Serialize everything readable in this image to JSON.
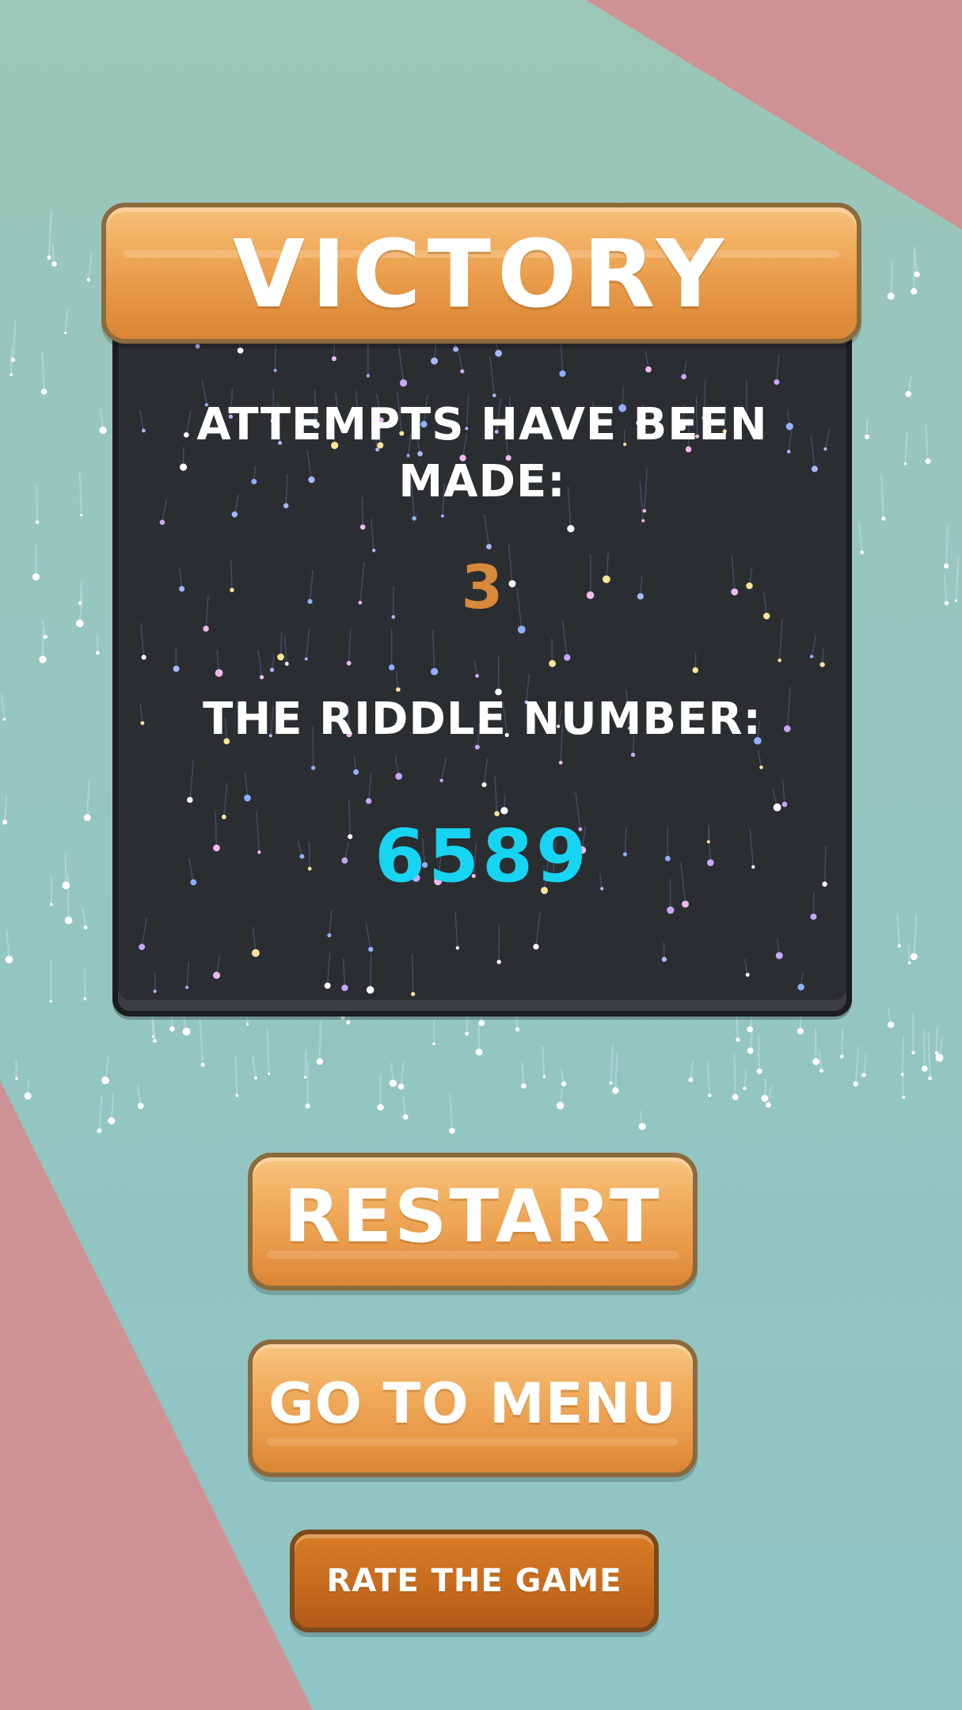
{
  "banner": {
    "title": "VICTORY"
  },
  "results": {
    "attempts_label": "ATTEMPTS HAVE BEEN MADE:",
    "attempts_value": "3",
    "riddle_label": "THE RIDDLE NUMBER:",
    "riddle_value": "6589"
  },
  "buttons": {
    "restart": "RESTART",
    "menu": "GO TO MENU",
    "rate": "RATE THE GAME"
  },
  "colors": {
    "background_teal": "#97c6bb",
    "background_pink": "#cf9294",
    "button_orange": "#f1ad5e",
    "rate_button_orange": "#c96d1e",
    "panel_dark": "#2b2e31",
    "attempts_value": "#d7893c",
    "riddle_value": "#16d4f2"
  }
}
